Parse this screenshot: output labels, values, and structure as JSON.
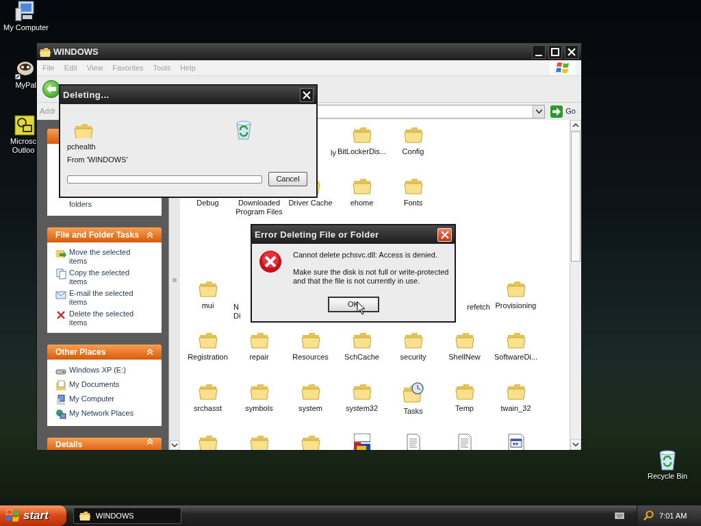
{
  "desktop_icons": [
    {
      "kind": "computer",
      "lines": [
        "My Computer"
      ]
    },
    {
      "kind": "mypal",
      "lines": [
        "MyPal"
      ]
    },
    {
      "kind": "outlook",
      "lines": [
        "Microsc",
        "Outloo"
      ]
    }
  ],
  "recycle_bin": {
    "lines": [
      "Recycle Bin"
    ]
  },
  "explorer": {
    "title": "WINDOWS",
    "menu": [
      "File",
      "Edit",
      "View",
      "Favorites",
      "Tools",
      "Help"
    ],
    "address_label": "Addr",
    "go": "Go",
    "panels": [
      {
        "kind": "partial",
        "items": [
          {
            "label": "folders"
          }
        ]
      },
      {
        "kind": "full",
        "title": "File and Folder Tasks",
        "items": [
          {
            "label": "Move the selected items"
          },
          {
            "label": "Copy the selected items"
          },
          {
            "label": "E-mail the selected items"
          },
          {
            "label": "Delete the selected items"
          }
        ]
      },
      {
        "kind": "full",
        "title": "Other Places",
        "items": [
          {
            "label": "Windows XP (E:)"
          },
          {
            "label": "My Documents"
          },
          {
            "label": "My Computer"
          },
          {
            "label": "My Network Places"
          }
        ]
      },
      {
        "kind": "cut",
        "title": "Details"
      }
    ],
    "rows": [
      [
        {
          "kind": "gap"
        },
        {
          "kind": "gap"
        },
        {
          "kind": "tail",
          "lines": [
            "ly"
          ]
        },
        {
          "kind": "folder",
          "lines": [
            "BitLockerDis..."
          ]
        },
        {
          "kind": "folder",
          "lines": [
            "Config"
          ]
        },
        {
          "kind": "gap"
        },
        {
          "kind": "gap"
        }
      ],
      [
        {
          "kind": "folder",
          "lines": [
            "Debug"
          ]
        },
        {
          "kind": "folder",
          "lines": [
            "Downloaded",
            "Program Files"
          ]
        },
        {
          "kind": "folder",
          "lines": [
            "Driver Cache"
          ]
        },
        {
          "kind": "folder",
          "lines": [
            "ehome"
          ]
        },
        {
          "kind": "folder",
          "lines": [
            "Fonts"
          ]
        },
        {
          "kind": "gap"
        },
        {
          "kind": "gap"
        }
      ],
      [
        {
          "kind": "gap"
        },
        {
          "kind": "gap"
        },
        {
          "kind": "gap"
        },
        {
          "kind": "gap"
        },
        {
          "kind": "gap"
        },
        {
          "kind": "gap"
        },
        {
          "kind": "gap"
        }
      ],
      [
        {
          "kind": "folder",
          "lines": [
            "mui"
          ]
        },
        {
          "kind": "head",
          "lines": [
            "N",
            "Di"
          ]
        },
        {
          "kind": "gap"
        },
        {
          "kind": "gap"
        },
        {
          "kind": "gap"
        },
        {
          "kind": "tail",
          "lines": [
            "refetch"
          ]
        },
        {
          "kind": "folder",
          "lines": [
            "Provisioning"
          ]
        }
      ],
      [
        {
          "kind": "folder",
          "lines": [
            "Registration"
          ]
        },
        {
          "kind": "folder",
          "lines": [
            "repair"
          ]
        },
        {
          "kind": "folder",
          "lines": [
            "Resources"
          ]
        },
        {
          "kind": "folder",
          "lines": [
            "SchCache"
          ]
        },
        {
          "kind": "folder",
          "lines": [
            "security"
          ]
        },
        {
          "kind": "folder",
          "lines": [
            "ShellNew"
          ]
        },
        {
          "kind": "folder",
          "lines": [
            "SoftwareDi..."
          ]
        }
      ],
      [
        {
          "kind": "folder",
          "lines": [
            "srchasst"
          ]
        },
        {
          "kind": "folder",
          "lines": [
            "symbols"
          ]
        },
        {
          "kind": "folder",
          "lines": [
            "system"
          ]
        },
        {
          "kind": "folder",
          "lines": [
            "system32"
          ]
        },
        {
          "kind": "tasks",
          "lines": [
            "Tasks"
          ]
        },
        {
          "kind": "folder",
          "lines": [
            "Temp"
          ]
        },
        {
          "kind": "folder",
          "lines": [
            "twain_32"
          ]
        }
      ],
      [
        {
          "kind": "folder"
        },
        {
          "kind": "folder"
        },
        {
          "kind": "folder"
        },
        {
          "kind": "msinfo"
        },
        {
          "kind": "doc"
        },
        {
          "kind": "doc"
        },
        {
          "kind": "app"
        }
      ]
    ]
  },
  "deleting_dialog": {
    "title": "Deleting...",
    "item": "pchealth",
    "from": "From 'WINDOWS'",
    "progress": {
      "level": 0
    },
    "cancel": "Cancel"
  },
  "error_dialog": {
    "title": "Error Deleting File or Folder",
    "message": "Cannot delete pchsvc.dll: Access is denied.",
    "details": "Make sure the disk is not full or write-protected and that the file is not currently in use.",
    "ok": "OK"
  },
  "taskbar": {
    "start": "start",
    "tasks": [
      {
        "label": "WINDOWS",
        "selected": true
      }
    ],
    "time": "7:01 AM"
  }
}
